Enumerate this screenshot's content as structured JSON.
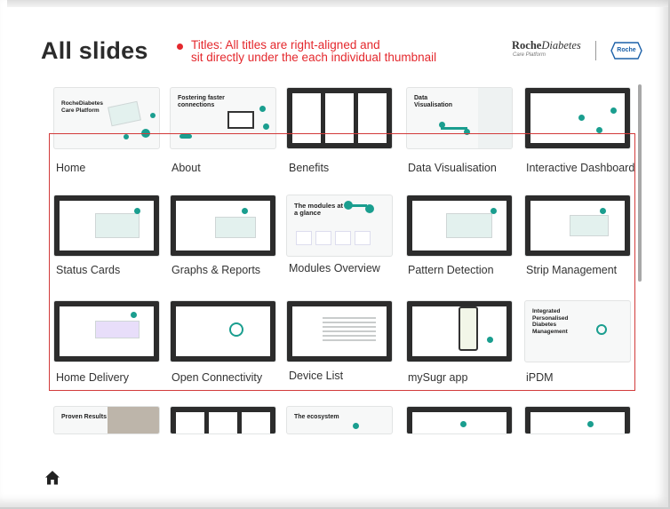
{
  "page": {
    "title": "All slides"
  },
  "annotation": {
    "line1": "Titles: All titles are right-aligned and",
    "line2": "sit directly under the each individual thumbnail",
    "color": "#e4282d"
  },
  "brand": {
    "name_bold": "Roche",
    "name_italic": "Diabetes",
    "subtitle": "Care Platform",
    "logo_text": "Roche"
  },
  "colors": {
    "accent": "#1a9e8f",
    "annotation_red": "#e4282d",
    "title": "#2b2b2b"
  },
  "slides": [
    {
      "title": "Home"
    },
    {
      "title": "About"
    },
    {
      "title": "Benefits"
    },
    {
      "title": "Data Visualisation"
    },
    {
      "title": "Interactive Dashboard"
    },
    {
      "title": "Status Cards"
    },
    {
      "title": "Graphs & Reports"
    },
    {
      "title": "Modules Overview"
    },
    {
      "title": "Pattern Detection"
    },
    {
      "title": "Strip Management"
    },
    {
      "title": "Home Delivery"
    },
    {
      "title": "Open Connectivity"
    },
    {
      "title": "Device List"
    },
    {
      "title": "mySugr app"
    },
    {
      "title": "iPDM"
    }
  ],
  "thumb_text": {
    "home": "RocheDiabetes Care Platform",
    "about": "Fostering faster connections",
    "datavis": "Data Visualisation",
    "modules": "The modules at a glance",
    "ipdm": "Integrated Personalised Diabetes Management",
    "proven": "Proven Results",
    "ecosystem": "The ecosystem"
  },
  "nav": {
    "home_icon": "home-icon"
  }
}
